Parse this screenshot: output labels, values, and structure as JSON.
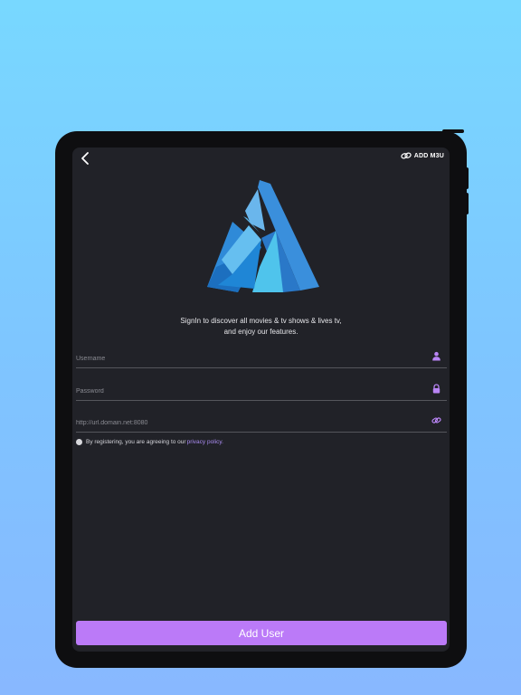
{
  "header": {
    "back_icon": "chevron-left-icon",
    "m3u_icon": "link-icon",
    "m3u_label": "ADD M3U"
  },
  "logo": {
    "icon": "triangle-aperture-logo",
    "colors": [
      "#2e7fd4",
      "#4bb0ea",
      "#1e88d8",
      "#5fc8f0",
      "#3498e0"
    ]
  },
  "tagline": {
    "line1": "SignIn to discover all movies & tv shows & lives tv,",
    "line2": "and enjoy our features."
  },
  "form": {
    "username_placeholder": "Username",
    "username_icon": "user-icon",
    "password_placeholder": "Password",
    "password_icon": "lock-icon",
    "url_placeholder": "http://url.domain.net:8080",
    "url_icon": "link-icon"
  },
  "consent": {
    "text": "By registering, you are agreeing to our ",
    "link": "privacy policy.",
    "link_color": "#a98bf0"
  },
  "add_button": {
    "label": "Add User",
    "color": "#bb7af8"
  }
}
